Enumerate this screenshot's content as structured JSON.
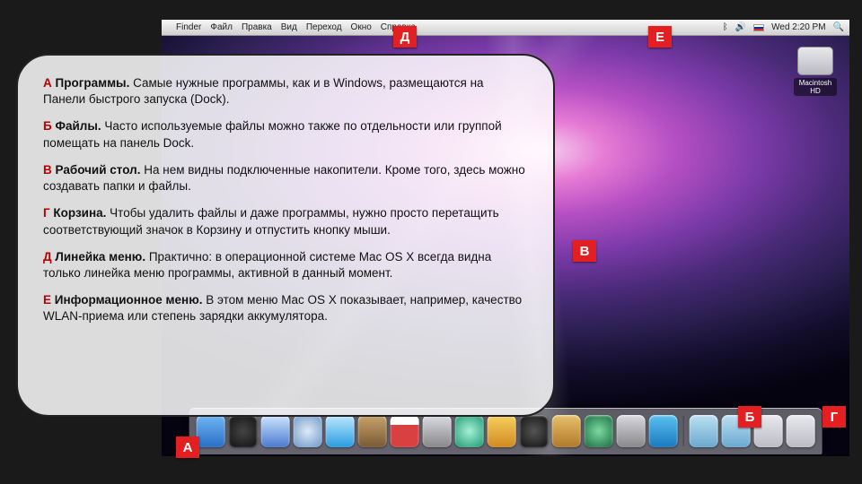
{
  "menubar": {
    "apple": "",
    "app": "Finder",
    "items": [
      "Файл",
      "Правка",
      "Вид",
      "Переход",
      "Окно",
      "Справка"
    ],
    "clock": "Wed 2:20 PM"
  },
  "desktop": {
    "hd_label": "Macintosh HD"
  },
  "dock": {
    "items": [
      {
        "name": "finder",
        "color": "linear-gradient(#6fb6f3,#2a6fc7)"
      },
      {
        "name": "dashboard",
        "color": "radial-gradient(circle,#444,#111)"
      },
      {
        "name": "mail",
        "color": "linear-gradient(#cfe6ff,#4a7bd0)"
      },
      {
        "name": "safari",
        "color": "radial-gradient(circle,#dfeaf6,#6a96c8)"
      },
      {
        "name": "ichat",
        "color": "linear-gradient(#bfe8ff,#2a9de0)"
      },
      {
        "name": "addressbook",
        "color": "linear-gradient(#c9a36b,#7a5a34)"
      },
      {
        "name": "ical",
        "color": "linear-gradient(#fff 0 30%,#d94040 30% 100%)"
      },
      {
        "name": "preview",
        "color": "linear-gradient(#dcdce4,#888)"
      },
      {
        "name": "itunes",
        "color": "radial-gradient(circle,#a8f0d8,#1a9a70)"
      },
      {
        "name": "iphoto",
        "color": "linear-gradient(#f7d160,#d08a20)"
      },
      {
        "name": "imovie",
        "color": "radial-gradient(circle,#555,#111)"
      },
      {
        "name": "garageband",
        "color": "linear-gradient(#e7c06a,#b07a2a)"
      },
      {
        "name": "timemachine",
        "color": "radial-gradient(circle,#7bdba0,#1a6a40)"
      },
      {
        "name": "sysprefs",
        "color": "linear-gradient(#d8d8de,#888)"
      },
      {
        "name": "appstore",
        "color": "linear-gradient(#5ac1f0,#1a7ac0)"
      },
      {
        "name": "folder-apps",
        "color": "linear-gradient(#bde0f2,#6aa9d0)"
      },
      {
        "name": "folder-docs",
        "color": "linear-gradient(#bde0f2,#6aa9d0)"
      },
      {
        "name": "folder-dl",
        "color": "linear-gradient(#e8e8ee,#bcbcc4)"
      },
      {
        "name": "trash",
        "color": "linear-gradient(#e8e8ee,#bcbcc4)"
      }
    ],
    "separator_after": 14
  },
  "markers": {
    "A": "А",
    "B": "Б",
    "V": "В",
    "G": "Г",
    "D": "Д",
    "E": "Е"
  },
  "card": {
    "items": [
      {
        "key": "А",
        "title": "Программы.",
        "text": "Самые нужные программы, как и в Windows, размещаются на Панели быстрого запуска (Dock)."
      },
      {
        "key": "Б",
        "title": "Файлы.",
        "text": "Часто используемые файлы можно также по отдельности или группой помещать на панель Dock."
      },
      {
        "key": "В",
        "title": "Рабочий стол.",
        "text": "На нем видны подключенные накопители. Кроме того, здесь можно создавать папки и файлы."
      },
      {
        "key": "Г",
        "title": "Корзина.",
        "text": "Чтобы удалить файлы и даже программы, нужно просто перетащить соответствующий значок в Корзину и отпустить кнопку мыши."
      },
      {
        "key": "Д",
        "title": "Линейка меню.",
        "text": "Практично: в операционной системе Mac OS X всегда видна только линейка меню программы, активной в данный момент."
      },
      {
        "key": "Е",
        "title": "Информационное меню.",
        "text": "В этом меню Mac OS X показывает, например, качество WLAN-приема или степень зарядки аккумулятора."
      }
    ]
  }
}
